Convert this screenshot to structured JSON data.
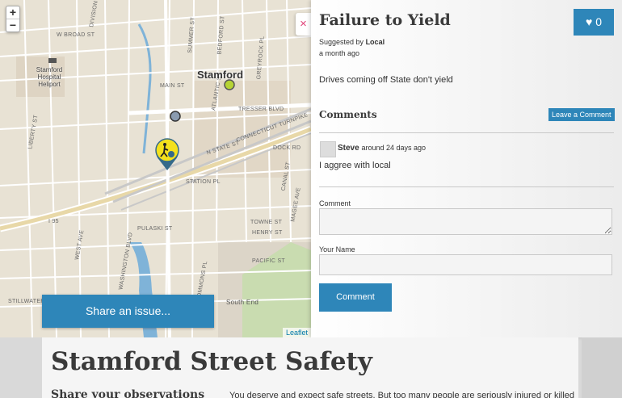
{
  "map": {
    "zoom_in": "+",
    "zoom_out": "−",
    "close": "×",
    "attribution": "Leaflet",
    "city_label": "Stamford",
    "heliport_label": "Stamford Hospital Heliport",
    "streets": [
      "DIVISION ST",
      "W BROAD ST",
      "SUMMER ST",
      "BEDFORD ST",
      "GREYROCK PL",
      "MAIN ST",
      "ATLANTIC ST",
      "TRESSER BLVD",
      "CONNECTICUT TURNPIKE",
      "N STATE ST",
      "STATION PL",
      "WASHINGTON BLVD",
      "I 95",
      "PULASKI ST",
      "DOCK RD",
      "CANAL ST",
      "MAGEE AVE",
      "TOWNE ST",
      "HENRY ST",
      "PACIFIC ST",
      "COMMONS PL",
      "South End",
      "STILLWATER AVE",
      "WEST AVE",
      "LIBERTY ST"
    ],
    "share_button": "Share an issue..."
  },
  "panel": {
    "title": "Failure to Yield",
    "like_icon": "heart-icon",
    "like_count": "0",
    "suggested_prefix": "Suggested by",
    "suggested_by": "Local",
    "time_ago": "a month ago",
    "description": "Drives coming off State don't yield",
    "comments_heading": "Comments",
    "leave_comment": "Leave a Comment",
    "comment": {
      "author": "Steve",
      "time": "around 24 days ago",
      "body": "I aggree with local"
    },
    "form": {
      "comment_label": "Comment",
      "name_label": "Your Name",
      "submit": "Comment"
    }
  },
  "content": {
    "site_title": "Stamford Street Safety",
    "sub_heading": "Share your observations",
    "intro": "You deserve and expect safe streets. But too many people are seriously injured or killed"
  },
  "colors": {
    "accent": "#2e86b9",
    "close_x": "#e0457b",
    "water": "#7fb3d8",
    "marker_yellow": "#f4e11c",
    "marker_green": "#b6d334"
  }
}
